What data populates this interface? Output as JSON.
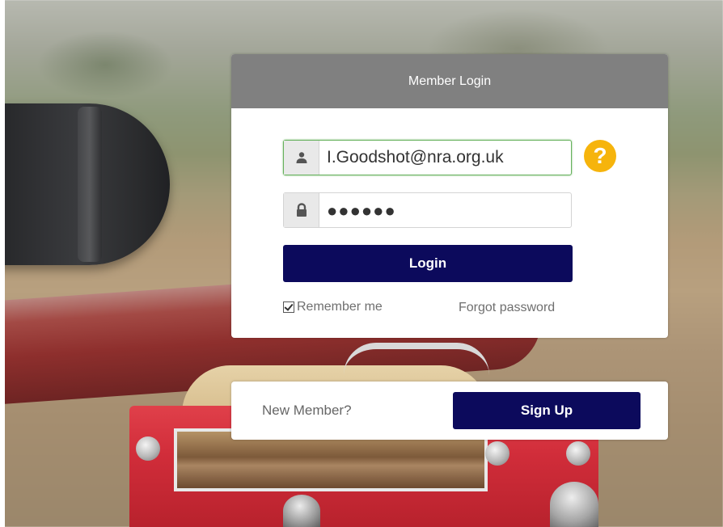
{
  "login": {
    "title": "Member Login",
    "email_value": "I.Goodshot@nra.org.uk",
    "password_masked": "●●●●●●",
    "help_symbol": "?",
    "login_label": "Login",
    "remember_label": "Remember me",
    "remember_checked": true,
    "forgot_label": "Forgot password"
  },
  "signup": {
    "prompt": "New Member?",
    "button_label": "Sign Up"
  },
  "icons": {
    "user": "user-icon",
    "lock": "lock-icon",
    "help": "help-icon",
    "checkbox": "checkbox-checked-icon"
  },
  "colors": {
    "header_bg": "#808080",
    "primary_button": "#0c0a5c",
    "help_icon": "#f6b40c",
    "focus_border": "#66b15c"
  }
}
